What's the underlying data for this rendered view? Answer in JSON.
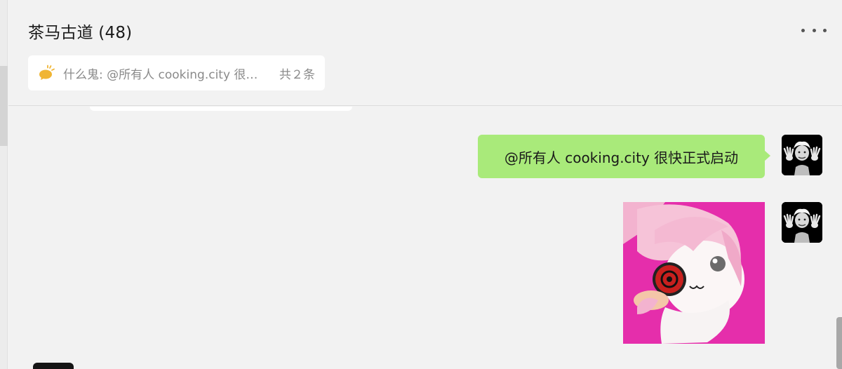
{
  "chat": {
    "title": "茶马古道 (48)",
    "more_icon": "more-horizontal-icon"
  },
  "notice": {
    "icon": "bullhorn-icon",
    "text": "什么鬼: @所有人 cooking.city 很快正式启动",
    "count": "共２条"
  },
  "messages": [
    {
      "type": "text",
      "text": "@所有人 cooking.city 很快正式启动",
      "bubble_color": "#a9ea7a"
    },
    {
      "type": "sticker",
      "description": "anime-girl-sticker"
    }
  ],
  "colors": {
    "background": "#f2f2f2",
    "bubble_self": "#a9ea7a",
    "notice_text": "#8a8a8a",
    "sticker_bg": "#e52eab"
  }
}
